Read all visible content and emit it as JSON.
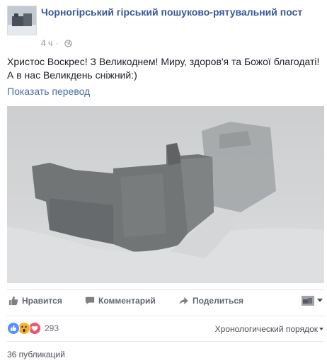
{
  "post": {
    "page_name": "Чорногірський гірський пошуково-рятувальний пост",
    "time": "4 ч",
    "privacy_icon": "globe-icon",
    "text_lines": [
      "Христос Воскрес! З Великоднем! Миру, здоров'я та Божої благодаті!",
      "А в нас Великдень сніжний:)"
    ],
    "translate_link": "Показать перевод"
  },
  "actions": {
    "like": "Нравится",
    "comment": "Комментарий",
    "share": "Поделиться"
  },
  "reactions": {
    "icons": [
      "like-icon",
      "wow-icon",
      "love-icon"
    ],
    "count": "293"
  },
  "comments": {
    "sort_label": "Хронологический порядок"
  },
  "shares": {
    "label": "36 публикаций"
  },
  "colors": {
    "link": "#365899",
    "like": "#5890ff",
    "love": "#f25268",
    "wow": "#f7b125"
  }
}
